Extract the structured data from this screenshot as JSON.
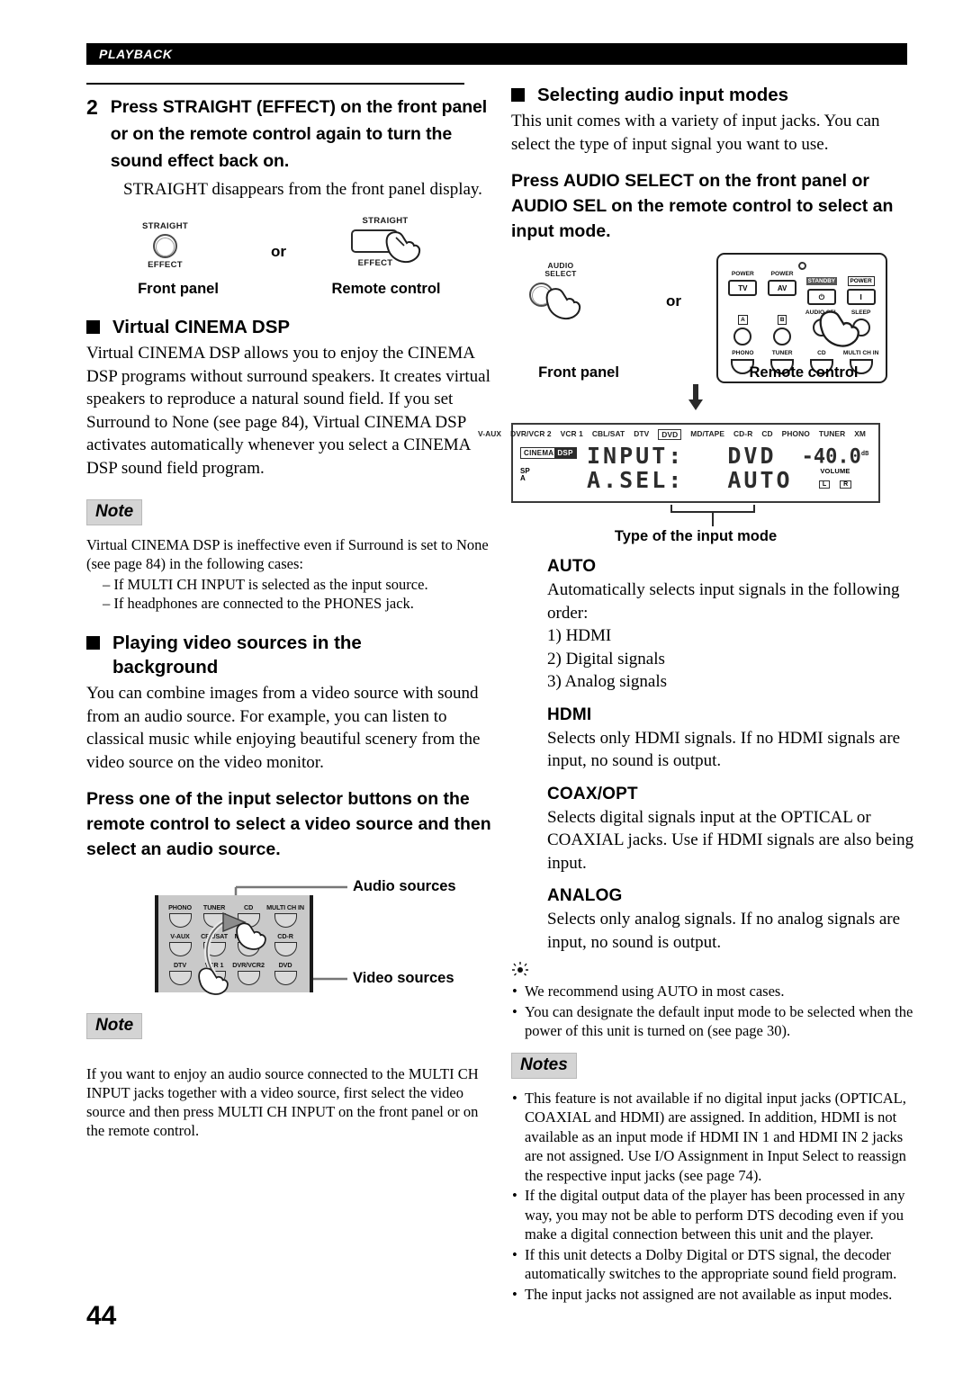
{
  "header": {
    "section_label": "PLAYBACK"
  },
  "page_number": "44",
  "left": {
    "step": {
      "number": "2",
      "title": "Press STRAIGHT (EFFECT) on the front panel or on the remote control again to turn the sound effect back on.",
      "subtext": "STRAIGHT disappears from the front panel display."
    },
    "fig_straight": {
      "front_label_top": "STRAIGHT",
      "front_label_bottom": "EFFECT",
      "or": "or",
      "remote_label_top": "STRAIGHT",
      "remote_label_bottom": "EFFECT",
      "caption_front": "Front panel",
      "caption_remote": "Remote control"
    },
    "virtual_cinema": {
      "heading": "Virtual CINEMA DSP",
      "body": "Virtual CINEMA DSP allows you to enjoy the CINEMA DSP programs without surround speakers. It creates virtual speakers to reproduce a natural sound field. If you set Surround to None (see page 84), Virtual CINEMA DSP activates automatically whenever you select a CINEMA DSP sound field program.",
      "note_badge": "Note",
      "note_body": "Virtual CINEMA DSP is ineffective even if Surround is set to None (see page 84) in the following cases:",
      "note_items": [
        "– If MULTI CH INPUT is selected as the input source.",
        "– If headphones are connected to the PHONES jack."
      ]
    },
    "playing_video": {
      "heading": "Playing video sources in the background",
      "body": "You can combine images from a video source with sound from an audio source. For example, you can listen to classical music while enjoying beautiful scenery from the video source on the video monitor.",
      "instruction": "Press one of the input selector buttons on the remote control to select a video source and then select an audio source."
    },
    "fig_selector": {
      "label_audio": "Audio sources",
      "label_video": "Video sources",
      "buttons": [
        "PHONO",
        "TUNER",
        "CD",
        "MULTI CH IN",
        "V-AUX",
        "CBL/SAT",
        "MD/TAPE",
        "CD-R",
        "DTV",
        "VCR 1",
        "DVR/VCR2",
        "DVD"
      ]
    },
    "note2": {
      "badge": "Note",
      "body": "If you want to enjoy an audio source connected to the MULTI CH INPUT jacks together with a video source, first select the video source and then press MULTI CH INPUT on the front panel or on the remote control."
    }
  },
  "right": {
    "selecting": {
      "heading": "Selecting audio input modes",
      "body": "This unit comes with a variety of input jacks. You can select the type of input signal you want to use.",
      "instruction": "Press AUDIO SELECT on the front panel or AUDIO SEL on the remote control to select an input mode."
    },
    "fig_audiosel": {
      "front_label": "AUDIO SELECT",
      "front_label_line1": "AUDIO",
      "front_label_line2": "SELECT",
      "or": "or",
      "caption_front": "Front panel",
      "caption_remote": "Remote control",
      "remote_buttons": {
        "row1_top": [
          "POWER",
          "POWER",
          "STANDBY",
          "POWER"
        ],
        "row1_face": [
          "TV",
          "AV",
          "⏻",
          "I"
        ],
        "row2": [
          "A",
          "B",
          "AUDIO SEL",
          "SLEEP"
        ],
        "row3": [
          "PHONO",
          "TUNER",
          "CD",
          "MULTI CH IN"
        ]
      }
    },
    "display": {
      "source_labels": [
        "V-AUX",
        "DVR/VCR 2",
        "VCR 1",
        "CBL/SAT",
        "DTV",
        "DVD",
        "MD/TAPE",
        "CD-R",
        "CD",
        "PHONO",
        "TUNER",
        "XM"
      ],
      "selected_source": "DVD",
      "badge_cinema": "CINEMA",
      "badge_dsp": "DSP",
      "sp_label": "SP",
      "sp_value": "A",
      "line1_label": "INPUT:",
      "line1_value": "DVD",
      "line2_label": "A.SEL:",
      "line2_value": "AUTO",
      "volume_value": "-40.0",
      "volume_unit": "dB",
      "volume_label": "VOLUME",
      "channel_left": "L",
      "channel_right": "R",
      "caption": "Type of the input mode"
    },
    "modes": [
      {
        "name": "AUTO",
        "desc": "Automatically selects input signals in the following order:",
        "list": [
          "1) HDMI",
          "2) Digital signals",
          "3) Analog signals"
        ]
      },
      {
        "name": "HDMI",
        "desc": "Selects only HDMI signals. If no HDMI signals are input, no sound is output.",
        "list": []
      },
      {
        "name": "COAX/OPT",
        "desc": "Selects digital signals input at the OPTICAL or COAXIAL jacks. Use if HDMI signals are also being input.",
        "list": []
      },
      {
        "name": "ANALOG",
        "desc": "Selects only analog signals. If no analog signals are input, no sound is output.",
        "list": []
      }
    ],
    "tips": [
      "We recommend using AUTO in most cases.",
      "You can designate the default input mode to be selected when the power of this unit is turned on (see page 30)."
    ],
    "notes": {
      "badge": "Notes",
      "items": [
        "This feature is not available if no digital input jacks (OPTICAL, COAXIAL and HDMI) are assigned. In addition, HDMI is not available as an input mode if HDMI IN 1 and HDMI IN 2 jacks are not assigned. Use I/O Assignment in Input Select to reassign the respective input jacks (see page 74).",
        "If the digital output data of the player has been processed in any way, you may not be able to perform DTS decoding even if you make a digital connection between this unit and the player.",
        "If this unit detects a Dolby Digital or DTS signal, the decoder automatically switches to the appropriate sound field program.",
        "The input jacks not assigned are not available as input modes."
      ]
    }
  }
}
